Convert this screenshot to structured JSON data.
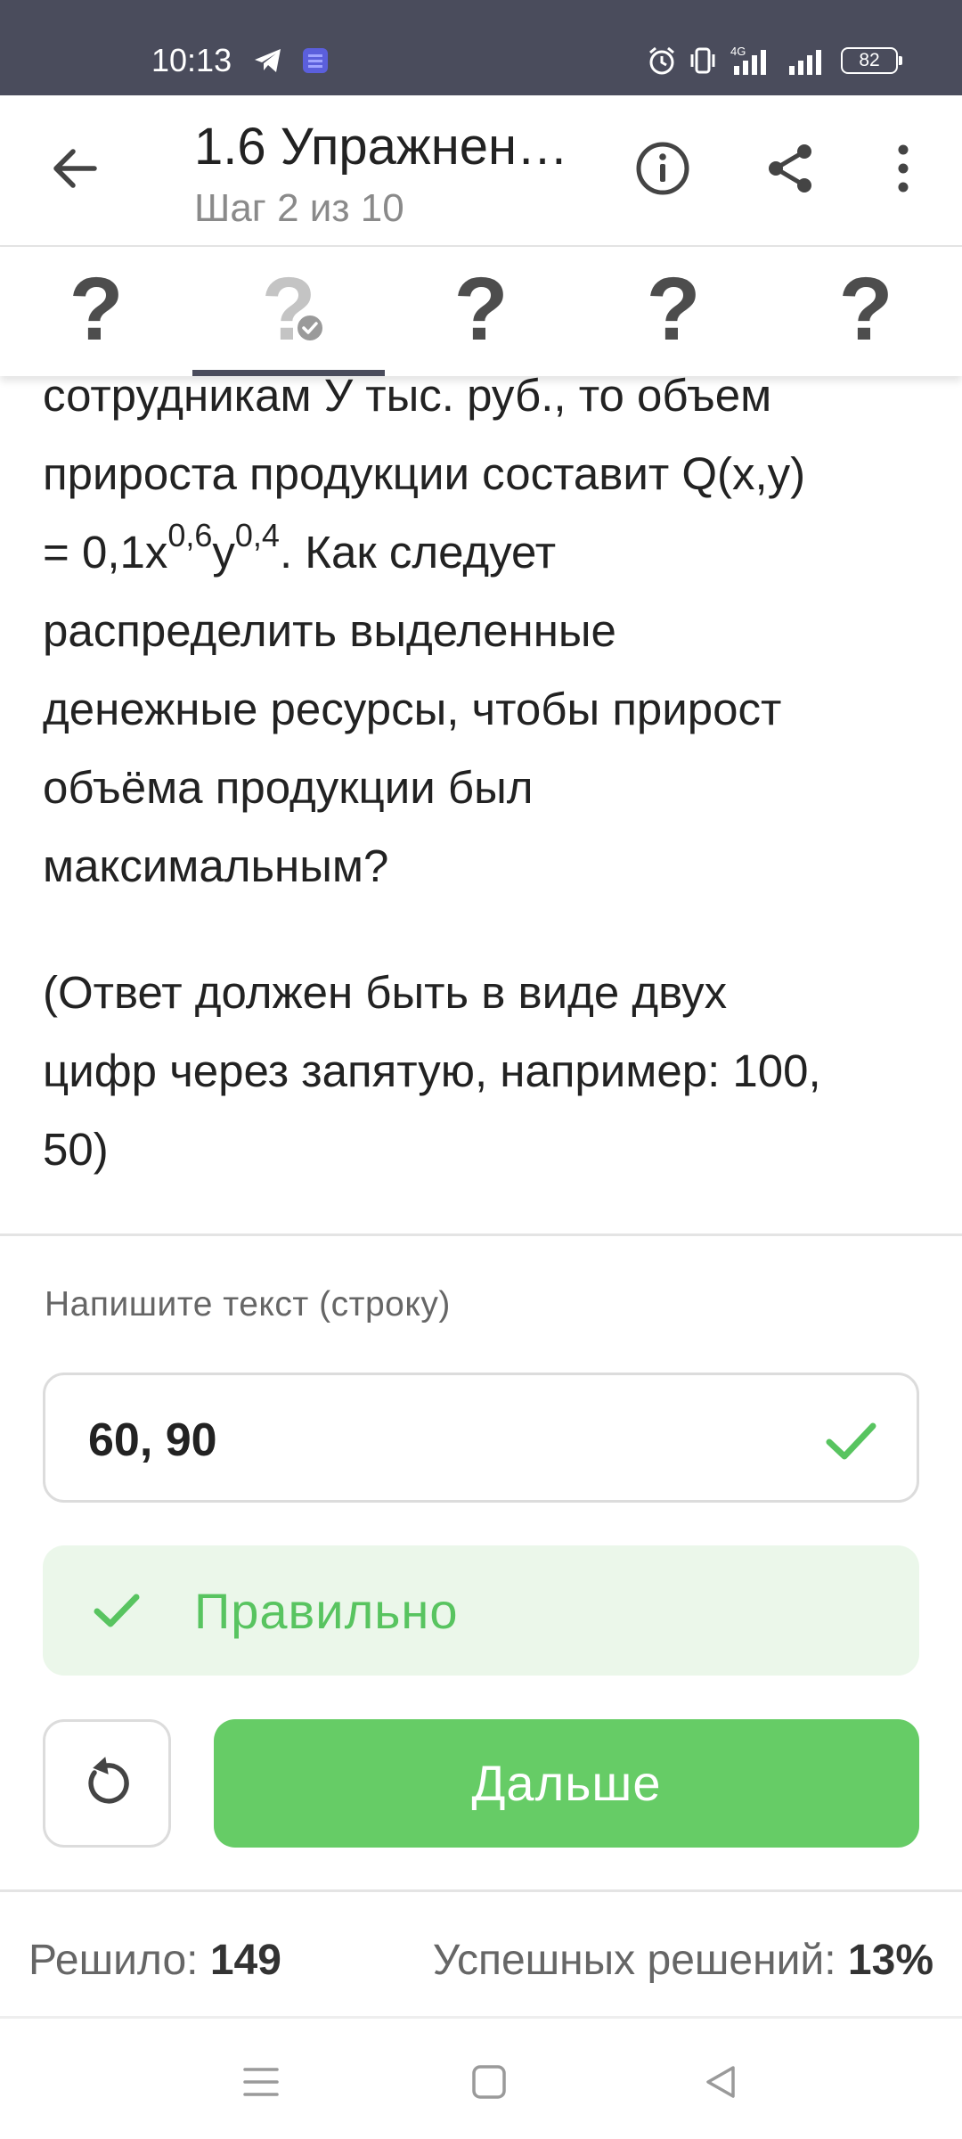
{
  "status_bar": {
    "time": "10:13",
    "network": "4G",
    "battery": "82"
  },
  "header": {
    "title": "1.6 Упражнен…",
    "step": "Шаг 2 из 10",
    "icons": [
      "back-arrow-icon",
      "info-icon",
      "share-icon",
      "more-vertical-icon"
    ]
  },
  "step_tabs": [
    {
      "label": "?",
      "state": "unsolved"
    },
    {
      "label": "?",
      "state": "solved-current"
    },
    {
      "label": "?",
      "state": "unsolved"
    },
    {
      "label": "?",
      "state": "unsolved"
    },
    {
      "label": "?",
      "state": "unsolved"
    }
  ],
  "problem": {
    "line1": "сотрудникам У тыс. руб., то   объем",
    "line2": "прироста продукции  составит Q(x,y)",
    "line3_prefix": "= 0,1x",
    "exp_x": "0,6",
    "line3_y": "y",
    "exp_y": "0,4",
    "line3_suffix": ". Как следует",
    "line4": "распределить выделенные",
    "line5": "денежные ресурсы, чтобы прирост",
    "line6": "объёма продукции был",
    "line7": "максимальным?",
    "note_line1": "(Ответ должен быть в виде двух",
    "note_line2": "цифр через запятую, например: 100,",
    "note_line3": "50)"
  },
  "answer": {
    "label": "Напишите текст (строку)",
    "value": "60, 90"
  },
  "result": {
    "label": "Правильно"
  },
  "actions": {
    "next_label": "Дальше"
  },
  "stats": {
    "solved_label": "Решило:",
    "solved_value": "149",
    "success_label": "Успешных решений:",
    "success_value": "13%"
  },
  "colors": {
    "status_bar": "#4a4c5c",
    "accent_green": "#66cc66",
    "success_bg": "#ebf7ea",
    "text": "#222222"
  }
}
